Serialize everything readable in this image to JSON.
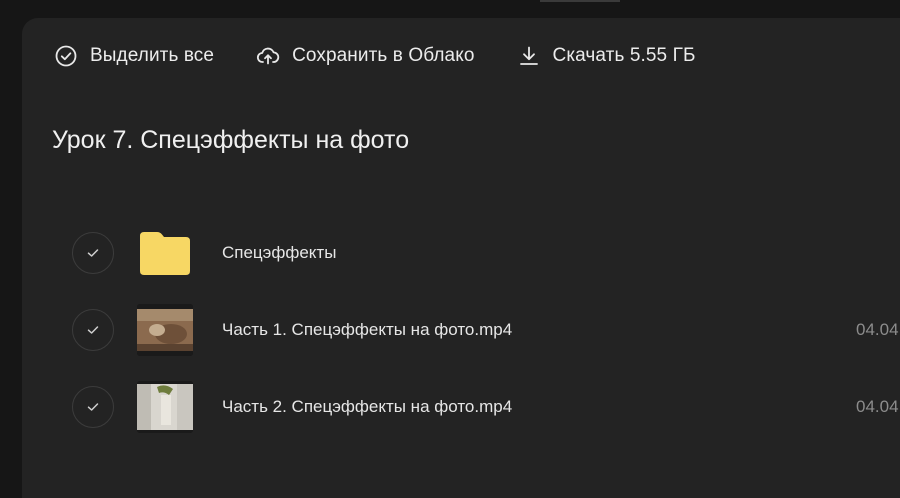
{
  "toolbar": {
    "select_all_label": "Выделить все",
    "save_cloud_label": "Сохранить в Облако",
    "download_label": "Скачать 5.55 ГБ"
  },
  "folder_title": "Урок 7. Спецэффекты на фото",
  "files": [
    {
      "name": "Спецэффекты",
      "type": "folder",
      "date": ""
    },
    {
      "name": "Часть 1. Спецэффекты на фото.mp4",
      "type": "video",
      "date": "04.04"
    },
    {
      "name": "Часть 2. Спецэффекты на фото.mp4",
      "type": "video",
      "date": "04.04"
    }
  ],
  "icons": {
    "select_all": "check-circle-icon",
    "save_cloud": "cloud-upload-icon",
    "download": "download-icon",
    "row_check": "checkmark-icon",
    "folder": "folder-icon"
  },
  "colors": {
    "background": "#161616",
    "panel": "#232323",
    "folder": "#f7d764",
    "text": "#e6e6e6",
    "muted": "#8c8c8c"
  }
}
